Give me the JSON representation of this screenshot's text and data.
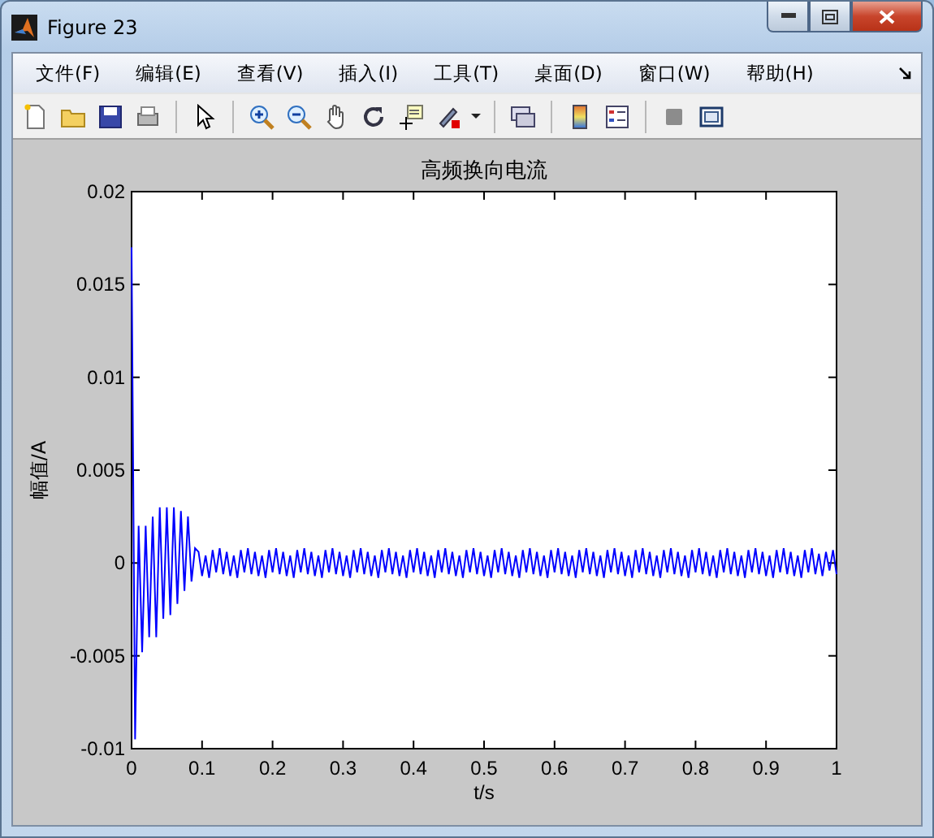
{
  "window": {
    "title": "Figure 23"
  },
  "menu": [
    {
      "label": "文件(F)"
    },
    {
      "label": "编辑(E)"
    },
    {
      "label": "查看(V)"
    },
    {
      "label": "插入(I)"
    },
    {
      "label": "工具(T)"
    },
    {
      "label": "桌面(D)"
    },
    {
      "label": "窗口(W)"
    },
    {
      "label": "帮助(H)"
    }
  ],
  "figure": {
    "chart_data": {
      "type": "line",
      "title": "高频换向电流",
      "xlabel": "t/s",
      "ylabel": "幅值/A",
      "xlim": [
        0,
        1
      ],
      "ylim": [
        -0.01,
        0.02
      ],
      "xticks": [
        {
          "value": 0,
          "label": "0"
        },
        {
          "value": 0.1,
          "label": "0.1"
        },
        {
          "value": 0.2,
          "label": "0.2"
        },
        {
          "value": 0.3,
          "label": "0.3"
        },
        {
          "value": 0.4,
          "label": "0.4"
        },
        {
          "value": 0.5,
          "label": "0.5"
        },
        {
          "value": 0.6,
          "label": "0.6"
        },
        {
          "value": 0.7,
          "label": "0.7"
        },
        {
          "value": 0.8,
          "label": "0.8"
        },
        {
          "value": 0.9,
          "label": "0.9"
        },
        {
          "value": 1,
          "label": "1"
        }
      ],
      "yticks": [
        {
          "value": -0.01,
          "label": "-0.01"
        },
        {
          "value": -0.005,
          "label": "-0.005"
        },
        {
          "value": 0,
          "label": "0"
        },
        {
          "value": 0.005,
          "label": "0.005"
        },
        {
          "value": 0.01,
          "label": "0.01"
        },
        {
          "value": 0.015,
          "label": "0.015"
        },
        {
          "value": 0.02,
          "label": "0.02"
        }
      ],
      "x": [
        0,
        0.005,
        0.01,
        0.015,
        0.02,
        0.025,
        0.03,
        0.035,
        0.04,
        0.045,
        0.05,
        0.055,
        0.06,
        0.065,
        0.07,
        0.075,
        0.08,
        0.085,
        0.09,
        0.095,
        0.1,
        0.105,
        0.11,
        0.115,
        0.12,
        0.125,
        0.13,
        0.135,
        0.14,
        0.145,
        0.15,
        0.155,
        0.16,
        0.165,
        0.17,
        0.175,
        0.18,
        0.185,
        0.19,
        0.195,
        0.2,
        0.205,
        0.21,
        0.215,
        0.22,
        0.225,
        0.23,
        0.235,
        0.24,
        0.245,
        0.25,
        0.255,
        0.26,
        0.265,
        0.27,
        0.275,
        0.28,
        0.285,
        0.29,
        0.295,
        0.3,
        0.305,
        0.31,
        0.315,
        0.32,
        0.325,
        0.33,
        0.335,
        0.34,
        0.345,
        0.35,
        0.355,
        0.36,
        0.365,
        0.37,
        0.375,
        0.38,
        0.385,
        0.39,
        0.395,
        0.4,
        0.405,
        0.41,
        0.415,
        0.42,
        0.425,
        0.43,
        0.435,
        0.44,
        0.445,
        0.45,
        0.455,
        0.46,
        0.465,
        0.47,
        0.475,
        0.48,
        0.485,
        0.49,
        0.495,
        0.5,
        0.505,
        0.51,
        0.515,
        0.52,
        0.525,
        0.53,
        0.535,
        0.54,
        0.545,
        0.55,
        0.555,
        0.56,
        0.565,
        0.57,
        0.575,
        0.58,
        0.585,
        0.59,
        0.595,
        0.6,
        0.605,
        0.61,
        0.615,
        0.62,
        0.625,
        0.63,
        0.635,
        0.64,
        0.645,
        0.65,
        0.655,
        0.66,
        0.665,
        0.67,
        0.675,
        0.68,
        0.685,
        0.69,
        0.695,
        0.7,
        0.705,
        0.71,
        0.715,
        0.72,
        0.725,
        0.73,
        0.735,
        0.74,
        0.745,
        0.75,
        0.755,
        0.76,
        0.765,
        0.77,
        0.775,
        0.78,
        0.785,
        0.79,
        0.795,
        0.8,
        0.805,
        0.81,
        0.815,
        0.82,
        0.825,
        0.83,
        0.835,
        0.84,
        0.845,
        0.85,
        0.855,
        0.86,
        0.865,
        0.87,
        0.875,
        0.88,
        0.885,
        0.89,
        0.895,
        0.9,
        0.905,
        0.91,
        0.915,
        0.92,
        0.925,
        0.93,
        0.935,
        0.94,
        0.945,
        0.95,
        0.955,
        0.96,
        0.965,
        0.97,
        0.975,
        0.98,
        0.985,
        0.99,
        0.995,
        1
      ],
      "series": [
        {
          "color": "#0000ff",
          "values": [
            0.017,
            -0.0095,
            0.002,
            -0.0048,
            0.002,
            -0.004,
            0.0025,
            -0.004,
            0.003,
            -0.003,
            0.003,
            -0.0028,
            0.003,
            -0.0022,
            0.0028,
            -0.0015,
            0.0025,
            -0.001,
            0.0008,
            0.0006,
            -0.0007,
            0.0004,
            -0.0008,
            0.0007,
            -0.0005,
            0.0008,
            -0.0006,
            0.0006,
            -0.0007,
            0.0004,
            -0.0008,
            0.0007,
            -0.0005,
            0.0008,
            -0.0006,
            0.0006,
            -0.0007,
            0.0004,
            -0.0008,
            0.0007,
            -0.0005,
            0.0008,
            -0.0006,
            0.0006,
            -0.0007,
            0.0004,
            -0.0008,
            0.0007,
            -0.0005,
            0.0008,
            -0.0006,
            0.0006,
            -0.0007,
            0.0004,
            -0.0008,
            0.0007,
            -0.0005,
            0.0008,
            -0.0006,
            0.0006,
            -0.0007,
            0.0004,
            -0.0008,
            0.0007,
            -0.0005,
            0.0008,
            -0.0006,
            0.0006,
            -0.0007,
            0.0004,
            -0.0008,
            0.0007,
            -0.0005,
            0.0008,
            -0.0006,
            0.0006,
            -0.0007,
            0.0004,
            -0.0008,
            0.0007,
            -0.0005,
            0.0008,
            -0.0006,
            0.0006,
            -0.0007,
            0.0004,
            -0.0008,
            0.0007,
            -0.0005,
            0.0008,
            -0.0006,
            0.0006,
            -0.0007,
            0.0004,
            -0.0008,
            0.0007,
            -0.0005,
            0.0008,
            -0.0006,
            0.0006,
            -0.0007,
            0.0004,
            -0.0008,
            0.0007,
            -0.0005,
            0.0008,
            -0.0006,
            0.0006,
            -0.0007,
            0.0004,
            -0.0008,
            0.0007,
            -0.0005,
            0.0008,
            -0.0006,
            0.0006,
            -0.0007,
            0.0004,
            -0.0008,
            0.0007,
            -0.0005,
            0.0008,
            -0.0006,
            0.0006,
            -0.0007,
            0.0004,
            -0.0008,
            0.0007,
            -0.0005,
            0.0008,
            -0.0006,
            0.0006,
            -0.0007,
            0.0004,
            -0.0008,
            0.0007,
            -0.0005,
            0.0008,
            -0.0006,
            0.0006,
            -0.0007,
            0.0004,
            -0.0008,
            0.0007,
            -0.0005,
            0.0008,
            -0.0006,
            0.0006,
            -0.0007,
            0.0004,
            -0.0008,
            0.0007,
            -0.0005,
            0.0008,
            -0.0006,
            0.0006,
            -0.0007,
            0.0004,
            -0.0008,
            0.0007,
            -0.0005,
            0.0008,
            -0.0006,
            0.0006,
            -0.0007,
            0.0004,
            -0.0008,
            0.0007,
            -0.0005,
            0.0008,
            -0.0006,
            0.0006,
            -0.0007,
            0.0004,
            -0.0008,
            0.0007,
            -0.0005,
            0.0008,
            -0.0006,
            0.0006,
            -0.0007,
            0.0004,
            -0.0008,
            0.0007,
            -0.0005,
            0.0008,
            -0.0006,
            0.0006,
            -0.0007,
            0.0004,
            -0.0008,
            0.0007,
            -0.0005,
            0.0008,
            -0.0006,
            0.0005,
            -0.0007,
            0.0006,
            -0.0004,
            0.0007,
            -0.0006
          ]
        }
      ]
    }
  }
}
